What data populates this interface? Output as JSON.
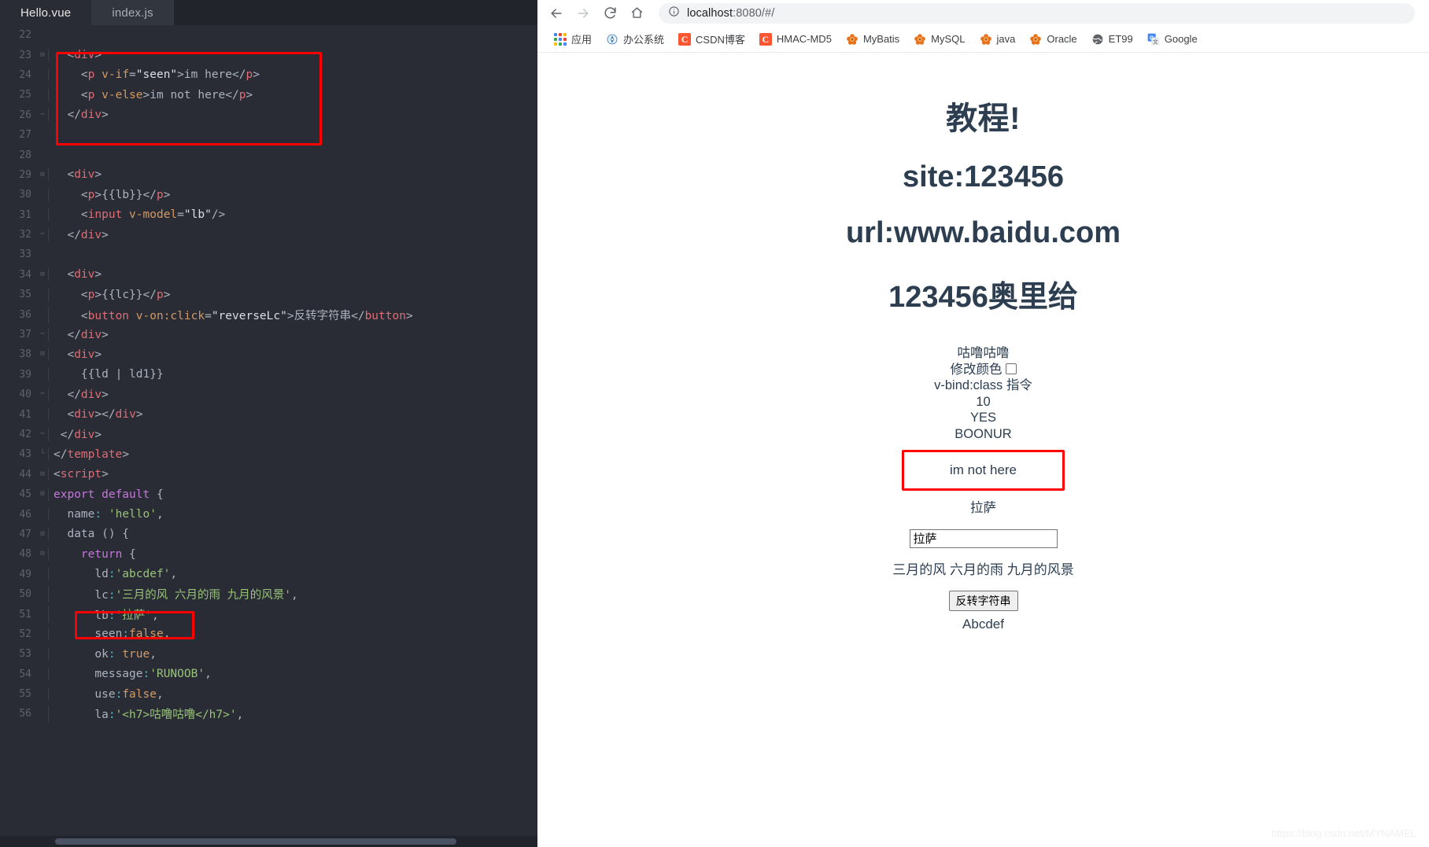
{
  "ide": {
    "tabs": [
      {
        "label": "Hello.vue",
        "active": true
      },
      {
        "label": "index.js",
        "active": false
      }
    ],
    "lines": [
      {
        "n": "22",
        "fold": "",
        "indent": 0,
        "tokens": []
      },
      {
        "n": "23",
        "fold": "⊟",
        "indent": 0,
        "tokens": [
          {
            "t": "punc",
            "v": "  <"
          },
          {
            "t": "tag",
            "v": "div"
          },
          {
            "t": "punc",
            "v": ">"
          }
        ]
      },
      {
        "n": "24",
        "fold": "",
        "indent": 0,
        "tokens": [
          {
            "t": "punc",
            "v": "    <"
          },
          {
            "t": "tag",
            "v": "p"
          },
          {
            "t": "txt",
            "v": " "
          },
          {
            "t": "attr",
            "v": "v-if"
          },
          {
            "t": "punc",
            "v": "="
          },
          {
            "t": "white",
            "v": "\"seen\""
          },
          {
            "t": "punc",
            "v": ">"
          },
          {
            "t": "txt",
            "v": "im here"
          },
          {
            "t": "punc",
            "v": "</"
          },
          {
            "t": "tag",
            "v": "p"
          },
          {
            "t": "punc",
            "v": ">"
          }
        ]
      },
      {
        "n": "25",
        "fold": "",
        "indent": 0,
        "tokens": [
          {
            "t": "punc",
            "v": "    <"
          },
          {
            "t": "tag",
            "v": "p"
          },
          {
            "t": "txt",
            "v": " "
          },
          {
            "t": "attr",
            "v": "v-else"
          },
          {
            "t": "punc",
            "v": ">"
          },
          {
            "t": "txt",
            "v": "im not here"
          },
          {
            "t": "punc",
            "v": "</"
          },
          {
            "t": "tag",
            "v": "p"
          },
          {
            "t": "punc",
            "v": ">"
          }
        ]
      },
      {
        "n": "26",
        "fold": "─",
        "indent": 0,
        "tokens": [
          {
            "t": "punc",
            "v": "  </"
          },
          {
            "t": "tag",
            "v": "div"
          },
          {
            "t": "punc",
            "v": ">"
          }
        ]
      },
      {
        "n": "27",
        "fold": "",
        "indent": 0,
        "tokens": []
      },
      {
        "n": "28",
        "fold": "",
        "indent": 0,
        "tokens": []
      },
      {
        "n": "29",
        "fold": "⊟",
        "indent": 0,
        "tokens": [
          {
            "t": "punc",
            "v": "  <"
          },
          {
            "t": "tag",
            "v": "div"
          },
          {
            "t": "punc",
            "v": ">"
          }
        ]
      },
      {
        "n": "30",
        "fold": "",
        "indent": 0,
        "tokens": [
          {
            "t": "punc",
            "v": "    <"
          },
          {
            "t": "tag",
            "v": "p"
          },
          {
            "t": "punc",
            "v": ">"
          },
          {
            "t": "txt",
            "v": "{{lb}}"
          },
          {
            "t": "punc",
            "v": "</"
          },
          {
            "t": "tag",
            "v": "p"
          },
          {
            "t": "punc",
            "v": ">"
          }
        ]
      },
      {
        "n": "31",
        "fold": "",
        "indent": 0,
        "tokens": [
          {
            "t": "punc",
            "v": "    <"
          },
          {
            "t": "tag",
            "v": "input"
          },
          {
            "t": "txt",
            "v": " "
          },
          {
            "t": "attr",
            "v": "v-model"
          },
          {
            "t": "punc",
            "v": "="
          },
          {
            "t": "white",
            "v": "\"lb\""
          },
          {
            "t": "punc",
            "v": "/>"
          }
        ]
      },
      {
        "n": "32",
        "fold": "─",
        "indent": 0,
        "tokens": [
          {
            "t": "punc",
            "v": "  </"
          },
          {
            "t": "tag",
            "v": "div"
          },
          {
            "t": "punc",
            "v": ">"
          }
        ]
      },
      {
        "n": "33",
        "fold": "",
        "indent": 0,
        "tokens": []
      },
      {
        "n": "34",
        "fold": "⊟",
        "indent": 0,
        "tokens": [
          {
            "t": "punc",
            "v": "  <"
          },
          {
            "t": "tag",
            "v": "div"
          },
          {
            "t": "punc",
            "v": ">"
          }
        ]
      },
      {
        "n": "35",
        "fold": "",
        "indent": 0,
        "tokens": [
          {
            "t": "punc",
            "v": "    <"
          },
          {
            "t": "tag",
            "v": "p"
          },
          {
            "t": "punc",
            "v": ">"
          },
          {
            "t": "txt",
            "v": "{{lc}}"
          },
          {
            "t": "punc",
            "v": "</"
          },
          {
            "t": "tag",
            "v": "p"
          },
          {
            "t": "punc",
            "v": ">"
          }
        ]
      },
      {
        "n": "36",
        "fold": "",
        "indent": 0,
        "tokens": [
          {
            "t": "punc",
            "v": "    <"
          },
          {
            "t": "tag",
            "v": "button"
          },
          {
            "t": "txt",
            "v": " "
          },
          {
            "t": "attr",
            "v": "v-on:click"
          },
          {
            "t": "punc",
            "v": "="
          },
          {
            "t": "white",
            "v": "\"reverseLc\""
          },
          {
            "t": "punc",
            "v": ">"
          },
          {
            "t": "txt",
            "v": "反转字符串"
          },
          {
            "t": "punc",
            "v": "</"
          },
          {
            "t": "tag",
            "v": "button"
          },
          {
            "t": "punc",
            "v": ">"
          }
        ]
      },
      {
        "n": "37",
        "fold": "─",
        "indent": 0,
        "tokens": [
          {
            "t": "punc",
            "v": "  </"
          },
          {
            "t": "tag",
            "v": "div"
          },
          {
            "t": "punc",
            "v": ">"
          }
        ]
      },
      {
        "n": "38",
        "fold": "⊟",
        "indent": 0,
        "tokens": [
          {
            "t": "punc",
            "v": "  <"
          },
          {
            "t": "tag",
            "v": "div"
          },
          {
            "t": "punc",
            "v": ">"
          }
        ]
      },
      {
        "n": "39",
        "fold": "",
        "indent": 0,
        "tokens": [
          {
            "t": "txt",
            "v": "    {{ld | ld1}}"
          }
        ]
      },
      {
        "n": "40",
        "fold": "─",
        "indent": 0,
        "tokens": [
          {
            "t": "punc",
            "v": "  </"
          },
          {
            "t": "tag",
            "v": "div"
          },
          {
            "t": "punc",
            "v": ">"
          }
        ]
      },
      {
        "n": "41",
        "fold": "",
        "indent": 0,
        "tokens": [
          {
            "t": "punc",
            "v": "  <"
          },
          {
            "t": "tag",
            "v": "div"
          },
          {
            "t": "punc",
            "v": "></"
          },
          {
            "t": "tag",
            "v": "div"
          },
          {
            "t": "punc",
            "v": ">"
          }
        ]
      },
      {
        "n": "42",
        "fold": "─",
        "indent": 0,
        "tokens": [
          {
            "t": "punc",
            "v": " </"
          },
          {
            "t": "tag",
            "v": "div"
          },
          {
            "t": "punc",
            "v": ">"
          }
        ]
      },
      {
        "n": "43",
        "fold": "└",
        "indent": 0,
        "tokens": [
          {
            "t": "punc",
            "v": "</"
          },
          {
            "t": "tag",
            "v": "template"
          },
          {
            "t": "punc",
            "v": ">"
          }
        ]
      },
      {
        "n": "44",
        "fold": "⊟",
        "indent": 0,
        "tokens": [
          {
            "t": "punc",
            "v": "<"
          },
          {
            "t": "tag",
            "v": "script"
          },
          {
            "t": "punc",
            "v": ">"
          }
        ]
      },
      {
        "n": "45",
        "fold": "⊟",
        "indent": 0,
        "tokens": [
          {
            "t": "kw",
            "v": "export default"
          },
          {
            "t": "punc",
            "v": " {"
          }
        ]
      },
      {
        "n": "46",
        "fold": "",
        "indent": 0,
        "tokens": [
          {
            "t": "prop",
            "v": "  name"
          },
          {
            "t": "cyan",
            "v": ":"
          },
          {
            "t": "txt",
            "v": " "
          },
          {
            "t": "str",
            "v": "'hello'"
          },
          {
            "t": "punc",
            "v": ","
          }
        ]
      },
      {
        "n": "47",
        "fold": "⊟",
        "indent": 0,
        "tokens": [
          {
            "t": "prop",
            "v": "  data"
          },
          {
            "t": "punc",
            "v": " () {"
          }
        ]
      },
      {
        "n": "48",
        "fold": "⊟",
        "indent": 0,
        "tokens": [
          {
            "t": "txt",
            "v": "    "
          },
          {
            "t": "kw",
            "v": "return"
          },
          {
            "t": "punc",
            "v": " {"
          }
        ]
      },
      {
        "n": "49",
        "fold": "",
        "indent": 0,
        "tokens": [
          {
            "t": "prop",
            "v": "      ld"
          },
          {
            "t": "cyan",
            "v": ":"
          },
          {
            "t": "str",
            "v": "'abcdef'"
          },
          {
            "t": "punc",
            "v": ","
          }
        ]
      },
      {
        "n": "50",
        "fold": "",
        "indent": 0,
        "tokens": [
          {
            "t": "prop",
            "v": "      lc"
          },
          {
            "t": "cyan",
            "v": ":"
          },
          {
            "t": "str",
            "v": "'三月的风 六月的雨 九月的风景'"
          },
          {
            "t": "punc",
            "v": ","
          }
        ]
      },
      {
        "n": "51",
        "fold": "",
        "indent": 0,
        "tokens": [
          {
            "t": "prop",
            "v": "      lb"
          },
          {
            "t": "cyan",
            "v": ":"
          },
          {
            "t": "str",
            "v": "'拉萨'"
          },
          {
            "t": "punc",
            "v": ","
          }
        ]
      },
      {
        "n": "52",
        "fold": "",
        "indent": 0,
        "tokens": [
          {
            "t": "prop",
            "v": "      seen"
          },
          {
            "t": "cyan",
            "v": ":"
          },
          {
            "t": "bool",
            "v": "false"
          },
          {
            "t": "punc",
            "v": ","
          }
        ]
      },
      {
        "n": "53",
        "fold": "",
        "indent": 0,
        "tokens": [
          {
            "t": "prop",
            "v": "      ok"
          },
          {
            "t": "cyan",
            "v": ":"
          },
          {
            "t": "txt",
            "v": " "
          },
          {
            "t": "bool",
            "v": "true"
          },
          {
            "t": "punc",
            "v": ","
          }
        ]
      },
      {
        "n": "54",
        "fold": "",
        "indent": 0,
        "tokens": [
          {
            "t": "prop",
            "v": "      message"
          },
          {
            "t": "cyan",
            "v": ":"
          },
          {
            "t": "str",
            "v": "'RUNOOB'"
          },
          {
            "t": "punc",
            "v": ","
          }
        ]
      },
      {
        "n": "55",
        "fold": "",
        "indent": 0,
        "tokens": [
          {
            "t": "prop",
            "v": "      use"
          },
          {
            "t": "cyan",
            "v": ":"
          },
          {
            "t": "bool",
            "v": "false"
          },
          {
            "t": "punc",
            "v": ","
          }
        ]
      },
      {
        "n": "56",
        "fold": "",
        "indent": 0,
        "tokens": [
          {
            "t": "prop",
            "v": "      la"
          },
          {
            "t": "cyan",
            "v": ":"
          },
          {
            "t": "str",
            "v": "'<h7>咕噜咕噜</h7>'"
          },
          {
            "t": "punc",
            "v": ","
          }
        ]
      }
    ],
    "highlight_color": "#ff0000"
  },
  "browser": {
    "nav": {
      "back_icon": "arrow-left-icon",
      "forward_icon": "arrow-right-icon",
      "reload_icon": "reload-icon",
      "home_icon": "home-icon",
      "info_icon": "info-circle-icon",
      "url_host": "localhost",
      "url_rest": ":8080/#/"
    },
    "bookmarks": [
      {
        "label": "应用",
        "icon": "apps-grid-icon"
      },
      {
        "label": "办公系统",
        "icon": "office-icon"
      },
      {
        "label": "CSDN博客",
        "icon": "csdn-icon"
      },
      {
        "label": "HMAC-MD5",
        "icon": "csdn-icon"
      },
      {
        "label": "MyBatis",
        "icon": "mybatis-flower-icon"
      },
      {
        "label": "MySQL",
        "icon": "mybatis-flower-icon"
      },
      {
        "label": "java",
        "icon": "mybatis-flower-icon"
      },
      {
        "label": "Oracle",
        "icon": "mybatis-flower-icon"
      },
      {
        "label": "ET99",
        "icon": "globe-icon"
      },
      {
        "label": "Google",
        "icon": "google-translate-icon"
      }
    ],
    "page": {
      "heading1": "教程!",
      "heading2": "site:123456",
      "heading3": "url:www.baidu.com",
      "heading4": "123456奥里给",
      "line_la": "咕噜咕噜",
      "line_color_label": "修改颜色",
      "line_vbind": "v-bind:class 指令",
      "line_num": "10",
      "line_yes": "YES",
      "line_boonur": "BOONUR",
      "boxed_text": "im not here",
      "lb_text": "拉萨",
      "input_value": "拉萨",
      "lc_text": "三月的风 六月的雨 九月的风景",
      "button_label": "反转字符串",
      "ld_text": "Abcdef"
    },
    "watermark": "https://blog.csdn.net/MYNAMEL"
  }
}
